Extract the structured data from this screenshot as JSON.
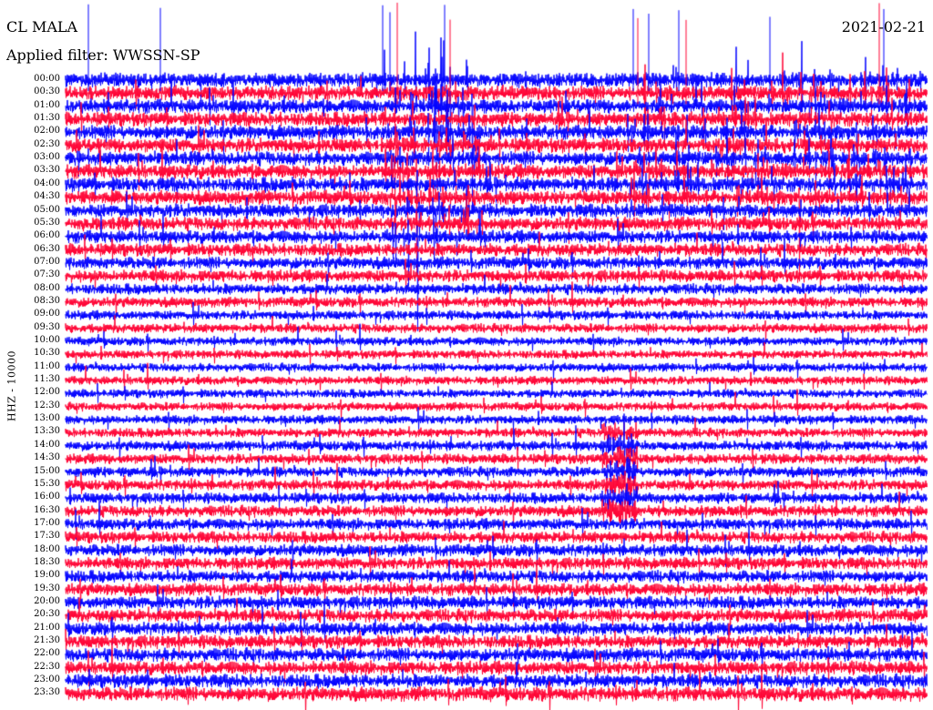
{
  "header": {
    "station": "CL MALA",
    "filter": "Applied filter: WWSSN-SP",
    "date": "2021-02-21"
  },
  "chart_data": {
    "type": "line",
    "title": "CL MALA",
    "subtitle": "Applied filter: WWSSN-SP",
    "ylabel": "HHZ - 10000",
    "row_labels": [
      "00:00",
      "00:30",
      "01:00",
      "01:30",
      "02:00",
      "02:30",
      "03:00",
      "03:30",
      "04:00",
      "04:30",
      "05:00",
      "05:30",
      "06:00",
      "06:30",
      "07:00",
      "07:30",
      "08:00",
      "08:30",
      "09:00",
      "09:30",
      "10:00",
      "10:30",
      "11:00",
      "11:30",
      "12:00",
      "12:30",
      "13:00",
      "13:30",
      "14:00",
      "14:30",
      "15:00",
      "15:30",
      "16:00",
      "16:30",
      "17:00",
      "17:30",
      "18:00",
      "18:30",
      "19:00",
      "19:30",
      "20:00",
      "20:30",
      "21:00",
      "21:30",
      "22:00",
      "22:30",
      "23:00",
      "23:30"
    ],
    "series_colors": [
      "#0000ff",
      "#ff0033"
    ],
    "row_amplitude": [
      1.0,
      1.0,
      1.0,
      1.0,
      1.0,
      1.0,
      1.0,
      1.0,
      1.0,
      1.0,
      0.95,
      0.95,
      0.9,
      0.9,
      0.85,
      0.85,
      0.75,
      0.7,
      0.65,
      0.65,
      0.6,
      0.6,
      0.6,
      0.6,
      0.6,
      0.6,
      0.62,
      0.65,
      0.7,
      0.7,
      0.72,
      0.75,
      0.75,
      0.8,
      0.8,
      0.82,
      0.85,
      0.85,
      0.85,
      0.88,
      0.9,
      0.9,
      0.92,
      0.92,
      0.95,
      0.95,
      0.95,
      1.0
    ],
    "grid": false,
    "legend": "none"
  }
}
